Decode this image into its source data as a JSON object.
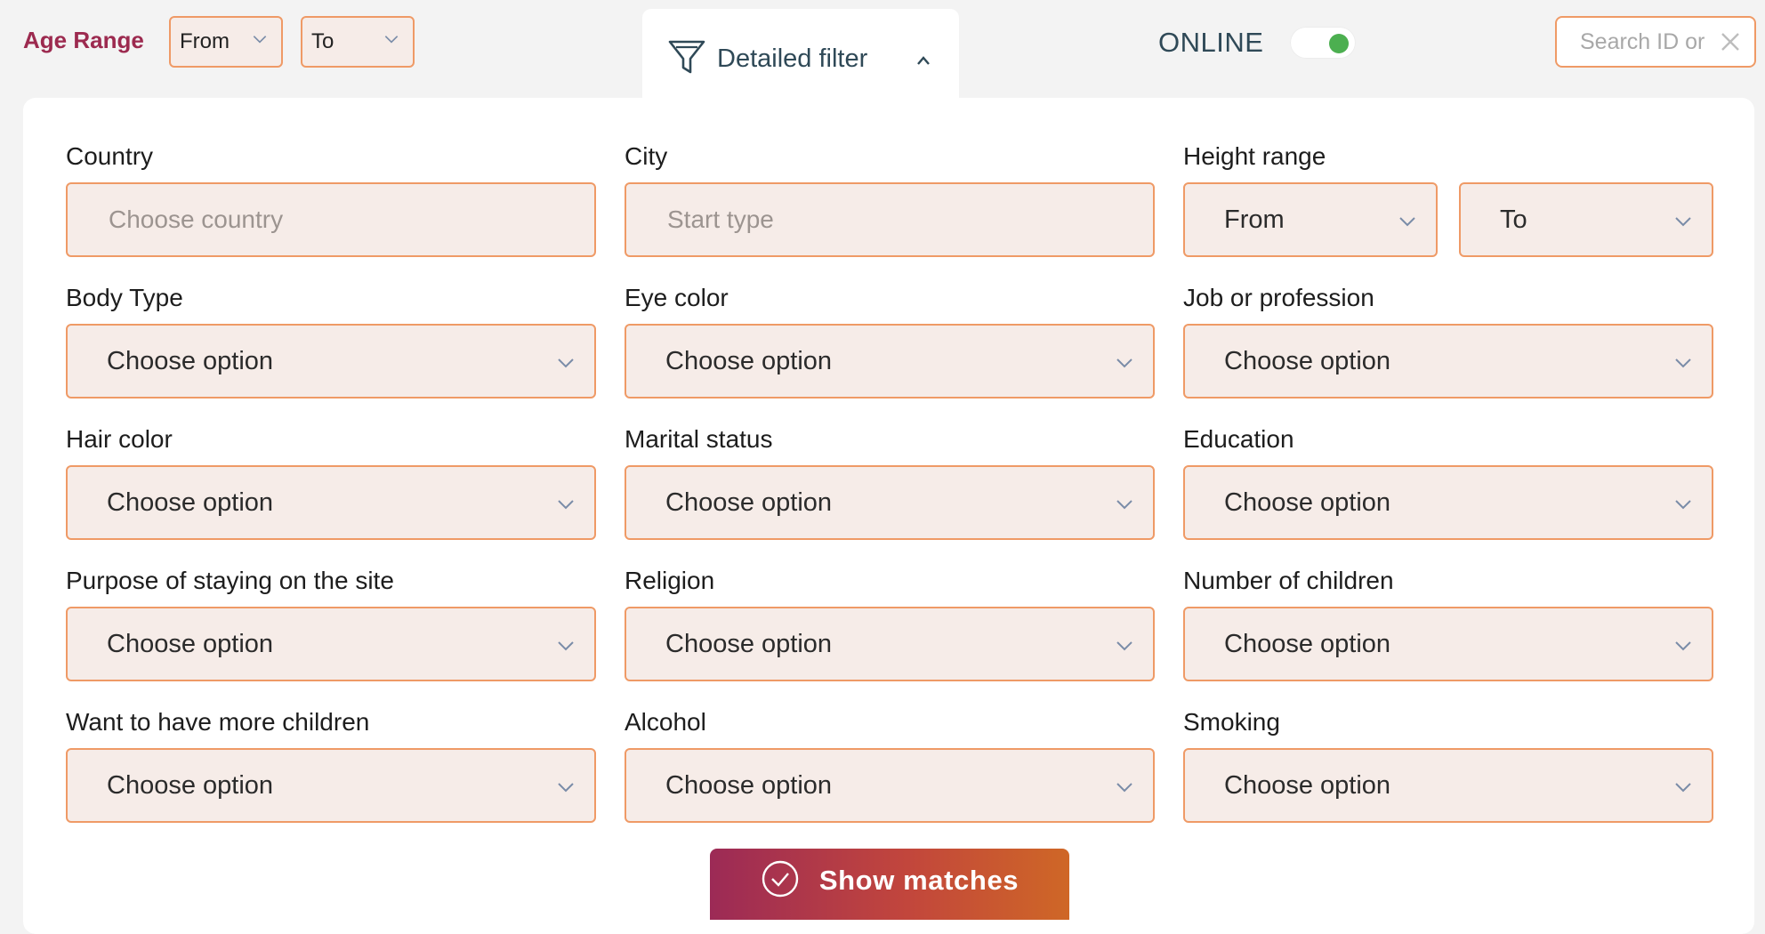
{
  "top_bar": {
    "age_range_label": "Age Range",
    "age_from": "From",
    "age_to": "To",
    "detailed_filter_label": "Detailed filter",
    "online_label": "ONLINE",
    "online_toggle_on": true,
    "search_placeholder": "Search ID or"
  },
  "filters": {
    "country": {
      "label": "Country",
      "placeholder": "Choose country"
    },
    "city": {
      "label": "City",
      "placeholder": "Start type"
    },
    "height_range": {
      "label": "Height range",
      "from": "From",
      "to": "To"
    },
    "body_type": {
      "label": "Body Type",
      "value": "Choose option"
    },
    "eye_color": {
      "label": "Eye color",
      "value": "Choose option"
    },
    "job": {
      "label": "Job or profession",
      "value": "Choose option"
    },
    "hair_color": {
      "label": "Hair color",
      "value": "Choose option"
    },
    "marital_status": {
      "label": "Marital status",
      "value": "Choose option"
    },
    "education": {
      "label": "Education",
      "value": "Choose option"
    },
    "purpose": {
      "label": "Purpose of staying on the site",
      "value": "Choose option"
    },
    "religion": {
      "label": "Religion",
      "value": "Choose option"
    },
    "children": {
      "label": "Number of children",
      "value": "Choose option"
    },
    "more_children": {
      "label": "Want to have more children",
      "value": "Choose option"
    },
    "alcohol": {
      "label": "Alcohol",
      "value": "Choose option"
    },
    "smoking": {
      "label": "Smoking",
      "value": "Choose option"
    }
  },
  "show_matches_label": "Show matches",
  "colors": {
    "accent_border": "#ef9a66",
    "field_bg": "#f6ece8",
    "age_label": "#9c2a4f",
    "online_dot": "#4caf50",
    "button_gradient_start": "#9c2a56",
    "button_gradient_end": "#cf6726"
  },
  "icons": [
    "chevron-down-icon",
    "funnel-icon",
    "chevron-up-icon",
    "close-icon",
    "check-circle-icon"
  ]
}
